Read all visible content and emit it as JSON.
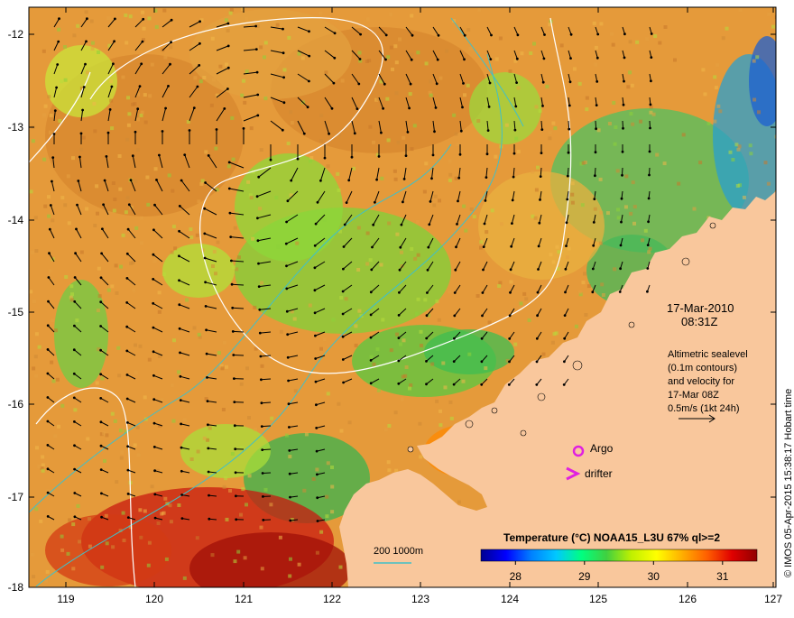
{
  "map": {
    "lon_min": 118.6,
    "lon_max": 127,
    "lat_min": -18,
    "lat_max": -11.65,
    "lon_ticks": [
      "119",
      "120",
      "121",
      "122",
      "123",
      "124",
      "125",
      "126",
      "127"
    ],
    "lat_ticks": [
      "-12",
      "-13",
      "-14",
      "-15",
      "-16",
      "-17",
      "-18"
    ],
    "land_color": "#f9c79c",
    "contour_color": "#ffffff",
    "isobath_color": "#40c0c8",
    "arrow_color": "#000000"
  },
  "datetime": {
    "date": "17-Mar-2010",
    "time": "08:31Z"
  },
  "annotation": {
    "line1": "Altimetric sealevel",
    "line2": "(0.1m contours)",
    "line3": "and velocity for",
    "line4": "17-Mar 08Z",
    "line5": "0.5m/s (1kt 24h)"
  },
  "legend_symbols": {
    "argo_label": "Argo",
    "drifter_label": "drifter",
    "symbol_color": "#e020e0"
  },
  "isobath_legend": {
    "label": "200  1000m"
  },
  "colorbar": {
    "title": "Temperature (°C) NOAA15_L3U 67% ql>=2",
    "min": 27.5,
    "max": 31.5,
    "tick_labels": [
      "28",
      "29",
      "30",
      "31"
    ],
    "colors": [
      "#000090",
      "#0000ff",
      "#0080ff",
      "#00c8ff",
      "#00ff80",
      "#40d040",
      "#c0f000",
      "#ffff00",
      "#ffb000",
      "#ff6000",
      "#e00000",
      "#900000"
    ]
  },
  "credit": {
    "text": "© IMOS 05-Apr-2015 15:38:17 Hobart time"
  }
}
